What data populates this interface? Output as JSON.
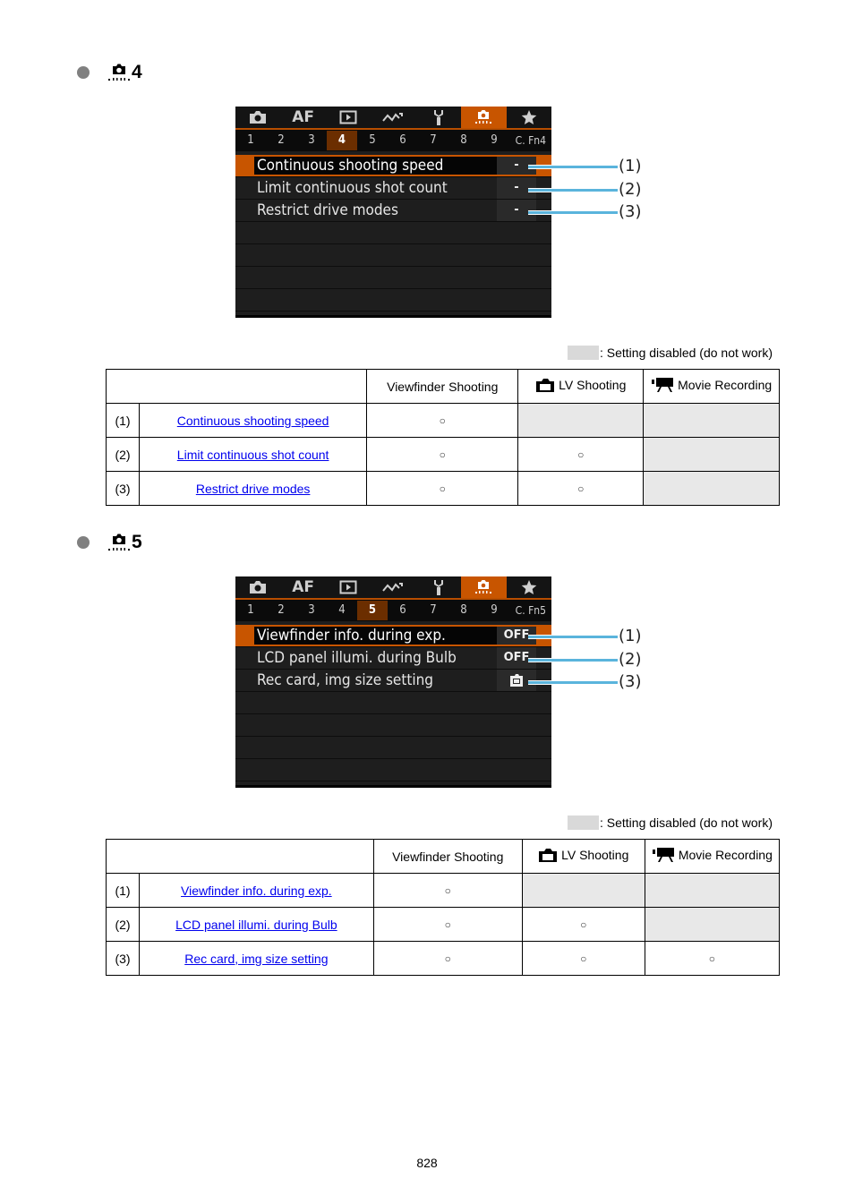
{
  "sections": [
    {
      "heading_number": "4",
      "heading_icon": "custom-function-camera-icon",
      "camera_screen": {
        "tabs": [
          {
            "icon": "camera-icon",
            "label": ""
          },
          {
            "icon": "af-icon",
            "label": "AF"
          },
          {
            "icon": "playback-icon",
            "label": ""
          },
          {
            "icon": "wireless-icon",
            "label": ""
          },
          {
            "icon": "setup-wrench-icon",
            "label": ""
          },
          {
            "icon": "custom-function-icon",
            "label": "",
            "active": true
          },
          {
            "icon": "my-menu-star-icon",
            "label": ""
          }
        ],
        "pages": [
          "1",
          "2",
          "3",
          "4",
          "5",
          "6",
          "7",
          "8",
          "9"
        ],
        "active_page": "4",
        "page_label": "C. Fn4",
        "items": [
          {
            "label": "Continuous shooting speed",
            "value": "-",
            "selected": true
          },
          {
            "label": "Limit continuous shot count",
            "value": "-"
          },
          {
            "label": "Restrict drive modes",
            "value": "-"
          }
        ],
        "callouts": [
          "(1)",
          "(2)",
          "(3)"
        ]
      },
      "legend": ": Setting disabled (do not work)",
      "table": {
        "headers": [
          "",
          "Viewfinder Shooting",
          "LV Shooting",
          "Movie Recording"
        ],
        "header_icons": [
          "",
          "",
          "lv-camera-icon",
          "movie-camera-icon"
        ],
        "rows": [
          {
            "num": "(1)",
            "name": "Continuous shooting speed",
            "viewfinder": "○",
            "lv": "",
            "lv_disabled": true,
            "movie": "",
            "movie_disabled": true
          },
          {
            "num": "(2)",
            "name": "Limit continuous shot count",
            "viewfinder": "○",
            "lv": "○",
            "lv_disabled": false,
            "movie": "",
            "movie_disabled": true
          },
          {
            "num": "(3)",
            "name": "Restrict drive modes",
            "viewfinder": "○",
            "lv": "○",
            "lv_disabled": false,
            "movie": "",
            "movie_disabled": true
          }
        ]
      }
    },
    {
      "heading_number": "5",
      "heading_icon": "custom-function-camera-icon",
      "camera_screen": {
        "tabs": [
          {
            "icon": "camera-icon",
            "label": ""
          },
          {
            "icon": "af-icon",
            "label": "AF"
          },
          {
            "icon": "playback-icon",
            "label": ""
          },
          {
            "icon": "wireless-icon",
            "label": ""
          },
          {
            "icon": "setup-wrench-icon",
            "label": ""
          },
          {
            "icon": "custom-function-icon",
            "label": "",
            "active": true
          },
          {
            "icon": "my-menu-star-icon",
            "label": ""
          }
        ],
        "pages": [
          "1",
          "2",
          "3",
          "4",
          "5",
          "6",
          "7",
          "8",
          "9"
        ],
        "active_page": "5",
        "page_label": "C. Fn5",
        "items": [
          {
            "label": "Viewfinder info. during exp.",
            "value": "OFF",
            "selected": true
          },
          {
            "label": "LCD panel illumi. during Bulb",
            "value": "OFF"
          },
          {
            "label": "Rec card, img size setting",
            "value": "",
            "value_icon": "card-icon"
          }
        ],
        "callouts": [
          "(1)",
          "(2)",
          "(3)"
        ]
      },
      "legend": ": Setting disabled (do not work)",
      "table": {
        "headers": [
          "",
          "Viewfinder Shooting",
          "LV Shooting",
          "Movie Recording"
        ],
        "header_icons": [
          "",
          "",
          "lv-camera-icon",
          "movie-camera-icon"
        ],
        "rows": [
          {
            "num": "(1)",
            "name": "Viewfinder info. during exp.",
            "viewfinder": "○",
            "lv": "",
            "lv_disabled": true,
            "movie": "",
            "movie_disabled": true
          },
          {
            "num": "(2)",
            "name": "LCD panel illumi. during Bulb",
            "viewfinder": "○",
            "lv": "○",
            "lv_disabled": false,
            "movie": "",
            "movie_disabled": true
          },
          {
            "num": "(3)",
            "name": "Rec card, img size setting",
            "viewfinder": "○",
            "lv": "○",
            "lv_disabled": false,
            "movie": "○",
            "movie_disabled": false
          }
        ]
      }
    }
  ],
  "colors": {
    "accent_orange": "#c85500",
    "callout_blue": "#5ab4dc",
    "disabled_gray": "#e8e8e8",
    "link_blue": "#0000ee"
  },
  "page_number": "828"
}
